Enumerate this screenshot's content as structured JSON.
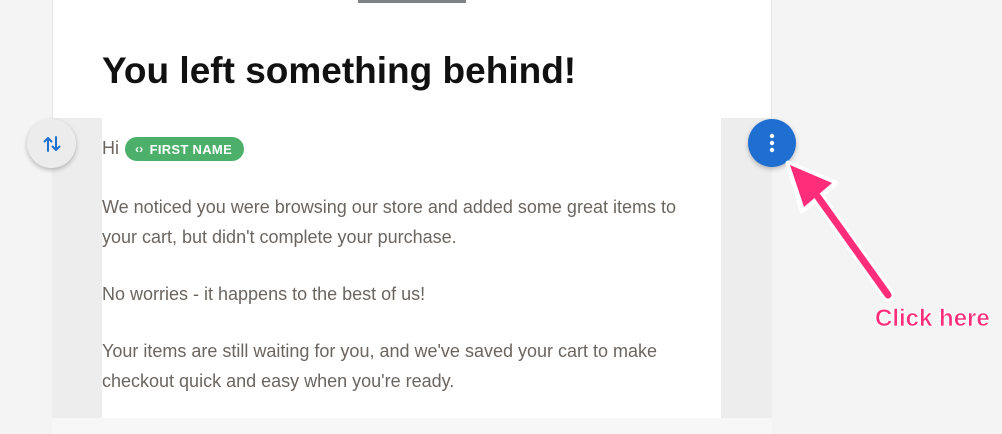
{
  "email": {
    "headline": "You left something behind!",
    "greeting": "Hi",
    "merge_tag": {
      "label": "FIRST NAME",
      "icon": "code-icon",
      "color": "#4caf6a"
    },
    "paragraph1_line1": "We noticed you were browsing our store and added some great items to",
    "paragraph1_line2": "your cart, but didn't complete your purchase.",
    "paragraph2": "No worries - it happens to the best of us!",
    "paragraph3_line1": "Your items are still waiting for you, and we've saved your cart to make",
    "paragraph3_line2": "checkout quick and easy when you're ready."
  },
  "controls": {
    "move_icon": "swap-vertical-icon",
    "more_icon": "more-vertical-icon",
    "more_color": "#1f6fd0"
  },
  "annotation": {
    "label": "Click here",
    "color": "#ff2d7a"
  }
}
